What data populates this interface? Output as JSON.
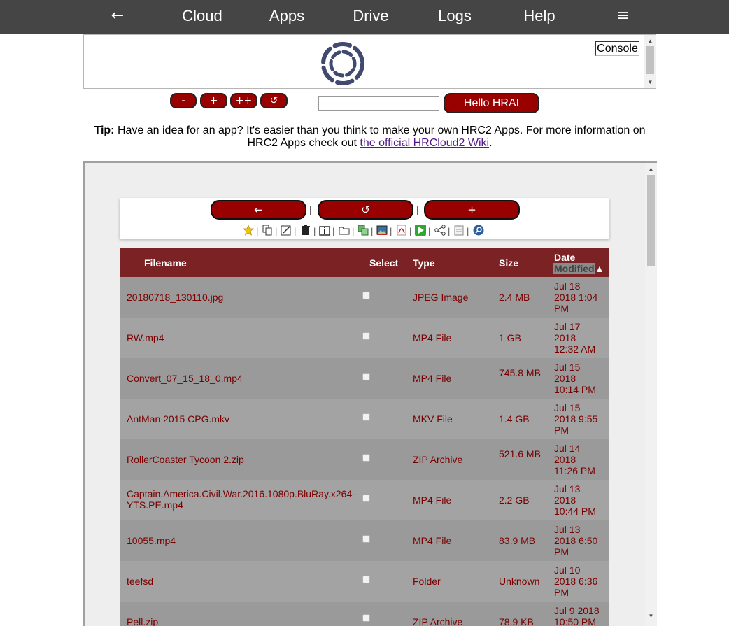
{
  "nav": {
    "back": "←",
    "items": [
      "Cloud",
      "Apps",
      "Drive",
      "Logs",
      "Help"
    ],
    "menu": "≡"
  },
  "console": {
    "button": "Console"
  },
  "controls": {
    "minus": "-",
    "plus": "+",
    "plusplus": "++",
    "refresh": "↺",
    "hrai_button": "Hello HRAI",
    "hrai_input_value": ""
  },
  "tip": {
    "label": "Tip:",
    "text_before": " Have an idea for an app? It's easier than you think to make your own HRC2 Apps. For more information on HRC2 Apps check out ",
    "link": "the official HRCloud2 Wiki",
    "text_after": "."
  },
  "drive": {
    "back": "←",
    "refresh": "↺",
    "add": "+",
    "pipe": "|",
    "icons": [
      "favorite-star-icon",
      "copy-icon",
      "rename-icon",
      "delete-icon",
      "archive-icon",
      "folder-icon",
      "convert-icon",
      "image-edit-icon",
      "pdf-icon",
      "play-icon",
      "share-icon",
      "clipboard-icon",
      "search-icon"
    ],
    "columns": {
      "filename": "Filename",
      "select": "Select",
      "type": "Type",
      "size": "Size",
      "date_line1": "Date",
      "date_line2": "Modified",
      "sort_arrow": "▲"
    },
    "files": [
      {
        "name": "20180718_130110.jpg",
        "type": "JPEG Image",
        "size": "2.4 MB",
        "date": [
          "Jul 18",
          "2018 1:04",
          "PM"
        ]
      },
      {
        "name": "RW.mp4",
        "type": "MP4 File",
        "size": "1 GB",
        "date": [
          "Jul 17",
          "2018",
          "12:32 AM"
        ]
      },
      {
        "name": "Convert_07_15_18_0.mp4",
        "type": "MP4 File",
        "size": "745.8 MB",
        "date": [
          "Jul 15",
          "2018",
          "10:14 PM"
        ]
      },
      {
        "name": "AntMan 2015 CPG.mkv",
        "type": "MKV File",
        "size": "1.4 GB",
        "date": [
          "Jul 15",
          "2018 9:55",
          "PM"
        ]
      },
      {
        "name": "RollerCoaster Tycoon 2.zip",
        "type": "ZIP Archive",
        "size": "521.6 MB",
        "date": [
          "Jul 14",
          "2018",
          "11:26 PM"
        ]
      },
      {
        "name": "Captain.America.Civil.War.2016.1080p.BluRay.x264-YTS.PE.mp4",
        "type": "MP4 File",
        "size": "2.2 GB",
        "date": [
          "Jul 13",
          "2018",
          "10:44 PM"
        ]
      },
      {
        "name": "10055.mp4",
        "type": "MP4 File",
        "size": "83.9 MB",
        "date": [
          "Jul 13",
          "2018 6:50",
          "PM"
        ]
      },
      {
        "name": "teefsd",
        "type": "Folder",
        "size": "Unknown",
        "date": [
          "Jul 10",
          "2018 6:36",
          "PM"
        ]
      },
      {
        "name": "Pell.zip",
        "type": "ZIP Archive",
        "size": "78.9 KB",
        "date": [
          "Jul 9 2018",
          "10:50 PM",
          ""
        ]
      }
    ]
  }
}
